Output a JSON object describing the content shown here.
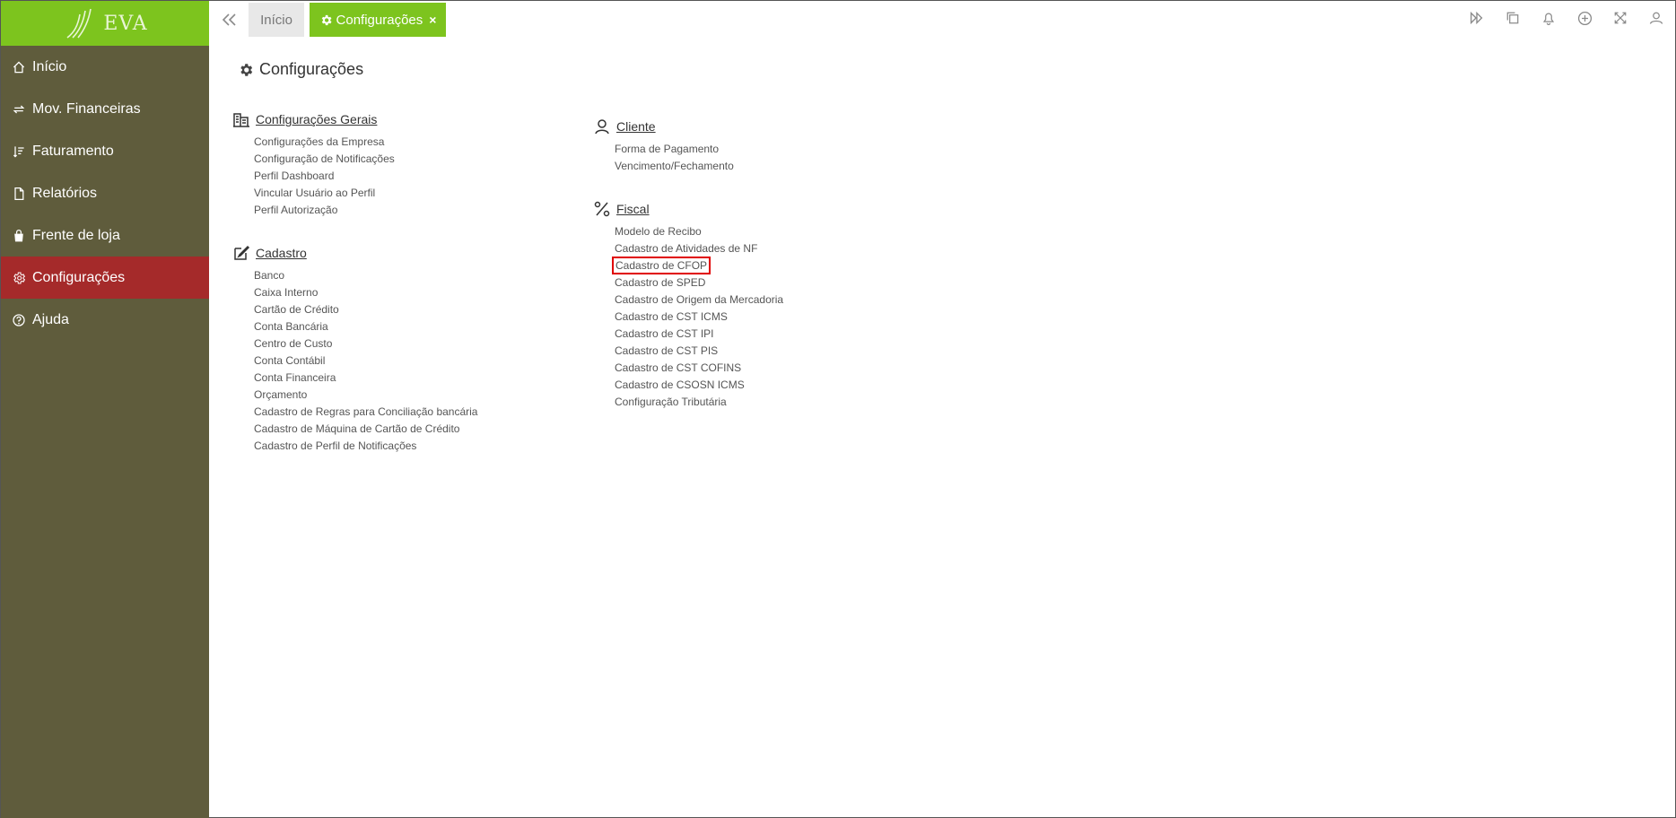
{
  "brand": {
    "logo_text": "EVA"
  },
  "sidebar": {
    "items": [
      {
        "label": "Início",
        "icon": "home-icon",
        "active": false
      },
      {
        "label": "Mov. Financeiras",
        "icon": "exchange-icon",
        "active": false
      },
      {
        "label": "Faturamento",
        "icon": "sort-list-icon",
        "active": false
      },
      {
        "label": "Relatórios",
        "icon": "document-icon",
        "active": false
      },
      {
        "label": "Frente de loja",
        "icon": "shopping-bag-icon",
        "active": false
      },
      {
        "label": "Configurações",
        "icon": "gear-icon",
        "active": true
      },
      {
        "label": "Ajuda",
        "icon": "help-circle-icon",
        "active": false
      }
    ]
  },
  "tabs": {
    "home_label": "Início",
    "active_label": "Configurações",
    "close_symbol": "×"
  },
  "top_icons": [
    "fast-forward-icon",
    "copy-icon",
    "bell-icon",
    "plus-circle-icon",
    "expand-icon",
    "user-icon"
  ],
  "page": {
    "title": "Configurações"
  },
  "sections": {
    "gerais": {
      "title": "Configurações Gerais",
      "icon": "building-icon",
      "links": [
        "Configurações da Empresa",
        "Configuração de Notificações",
        "Perfil Dashboard",
        "Vincular Usuário ao Perfil",
        "Perfil Autorização"
      ]
    },
    "cadastro": {
      "title": "Cadastro",
      "icon": "edit-icon",
      "links": [
        "Banco",
        "Caixa Interno",
        "Cartão de Crédito",
        "Conta Bancária",
        "Centro de Custo",
        "Conta Contábil",
        "Conta Financeira",
        "Orçamento",
        "Cadastro de Regras para Conciliação bancária",
        "Cadastro de Máquina de Cartão de Crédito",
        "Cadastro de Perfil de Notificações"
      ]
    },
    "cliente": {
      "title": "Cliente",
      "icon": "user-icon",
      "links": [
        "Forma de Pagamento",
        "Vencimento/Fechamento"
      ]
    },
    "fiscal": {
      "title": "Fiscal",
      "icon": "percent-icon",
      "links": [
        "Modelo de Recibo",
        "Cadastro de Atividades de NF",
        "Cadastro de CFOP",
        "Cadastro de SPED",
        "Cadastro de Origem da Mercadoria",
        "Cadastro de CST ICMS",
        "Cadastro de CST IPI",
        "Cadastro de CST PIS",
        "Cadastro de CST COFINS",
        "Cadastro de CSOSN ICMS",
        "Configuração Tributária"
      ],
      "highlighted": "Cadastro de CFOP"
    }
  },
  "colors": {
    "brand_green": "#7dc41e",
    "sidebar_bg": "#5f5c3c",
    "active_red": "#a52a2a",
    "highlight_outline": "#e00000"
  }
}
